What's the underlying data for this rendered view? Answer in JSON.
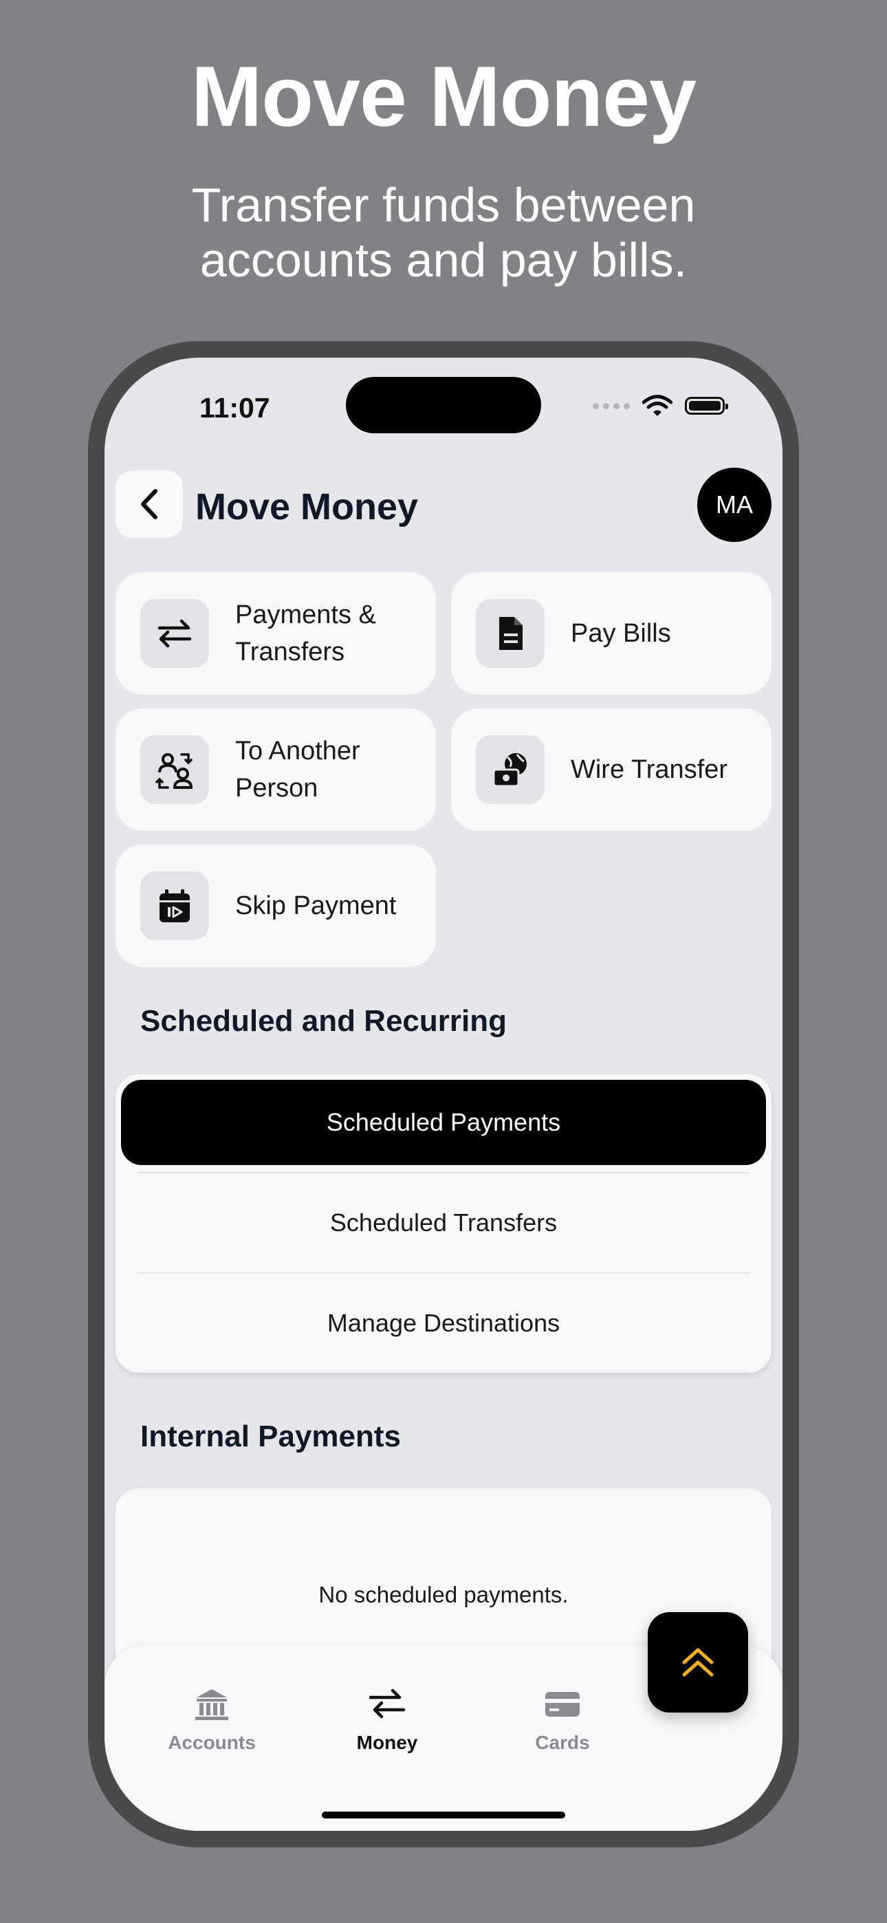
{
  "promo": {
    "headline": "Move Money",
    "subline": "Transfer funds between\naccounts and pay bills."
  },
  "status_bar": {
    "time": "11:07"
  },
  "header": {
    "title": "Move Money",
    "avatar_initials": "MA"
  },
  "actions": [
    {
      "label": "Payments &\nTransfers",
      "icon": "transfer-arrows-icon"
    },
    {
      "label": "Pay Bills",
      "icon": "document-icon"
    },
    {
      "label": "To Another\nPerson",
      "icon": "person-exchange-icon"
    },
    {
      "label": "Wire Transfer",
      "icon": "globe-money-icon"
    },
    {
      "label": "Skip Payment",
      "icon": "calendar-skip-icon"
    }
  ],
  "scheduled": {
    "title": "Scheduled and Recurring",
    "options": [
      "Scheduled Payments",
      "Scheduled Transfers",
      "Manage Destinations"
    ],
    "selected": "Scheduled Payments"
  },
  "internal_payments": {
    "title": "Internal Payments",
    "empty_text": "No scheduled payments."
  },
  "tabbar": {
    "tabs": [
      {
        "label": "Accounts",
        "icon": "bank-icon"
      },
      {
        "label": "Money",
        "icon": "transfer-arrows-icon"
      },
      {
        "label": "Cards",
        "icon": "card-icon"
      }
    ],
    "active": "Money",
    "fab_icon": "double-chevron-up-icon"
  },
  "colors": {
    "accent": "#f2b01e",
    "background": "#818286",
    "screen": "#e6e7eb",
    "card": "#f7f8fa"
  }
}
